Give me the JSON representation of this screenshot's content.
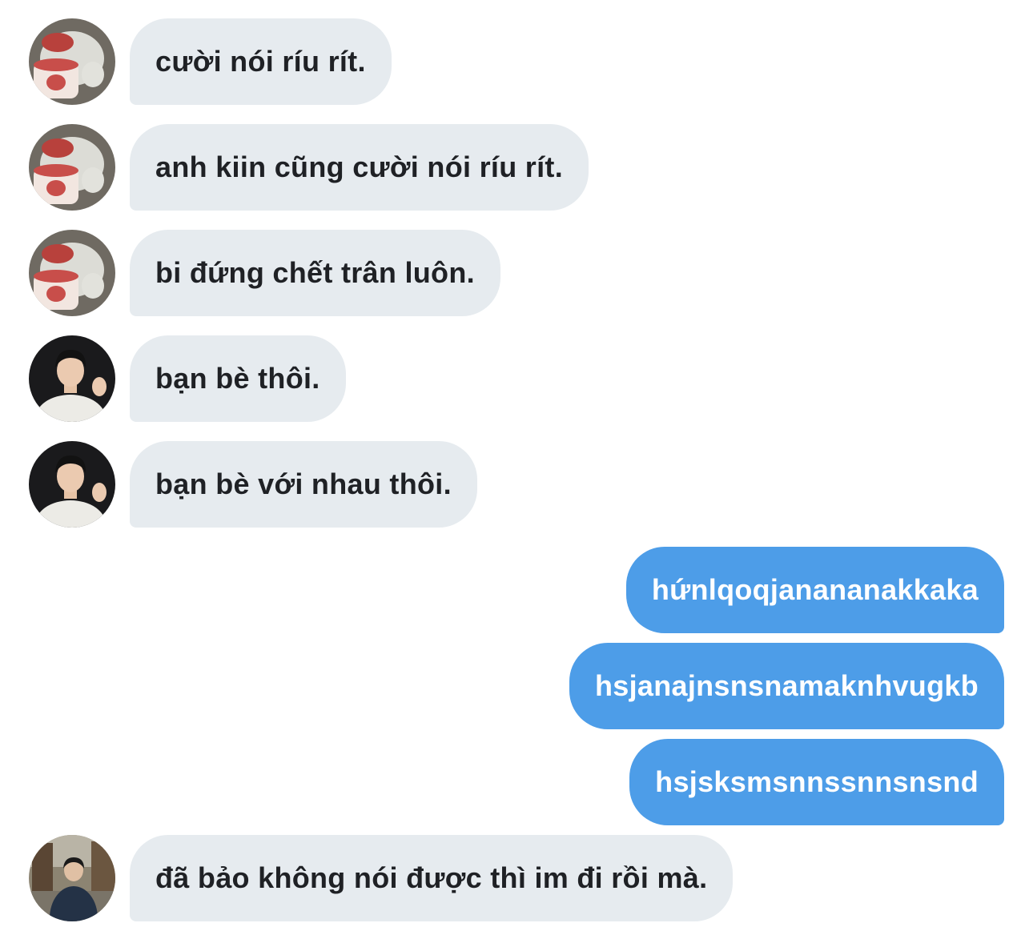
{
  "colors": {
    "incoming_bubble": "#e6ebef",
    "incoming_text": "#1f2125",
    "outgoing_bubble": "#4d9de8",
    "outgoing_text": "#ffffff"
  },
  "messages": [
    {
      "direction": "incoming",
      "avatar": "bear-avatar",
      "text": "cười nói ríu rít."
    },
    {
      "direction": "incoming",
      "avatar": "bear-avatar",
      "text": "anh kiin cũng cười nói ríu rít."
    },
    {
      "direction": "incoming",
      "avatar": "bear-avatar",
      "text": "bi đứng chết trân luôn."
    },
    {
      "direction": "incoming",
      "avatar": "man-white-shirt-avatar",
      "text": "bạn bè thôi."
    },
    {
      "direction": "incoming",
      "avatar": "man-white-shirt-avatar",
      "text": "bạn bè với nhau thôi."
    },
    {
      "direction": "outgoing",
      "text": "hứnlqoqjanananakkaka"
    },
    {
      "direction": "outgoing",
      "text": "hsjanajnsnsnamaknhvugkb"
    },
    {
      "direction": "outgoing",
      "text": "hsjsksmsnnssnnsnsnd"
    },
    {
      "direction": "incoming",
      "avatar": "man-street-avatar",
      "text": "đã bảo không nói được thì im đi rồi mà."
    }
  ]
}
